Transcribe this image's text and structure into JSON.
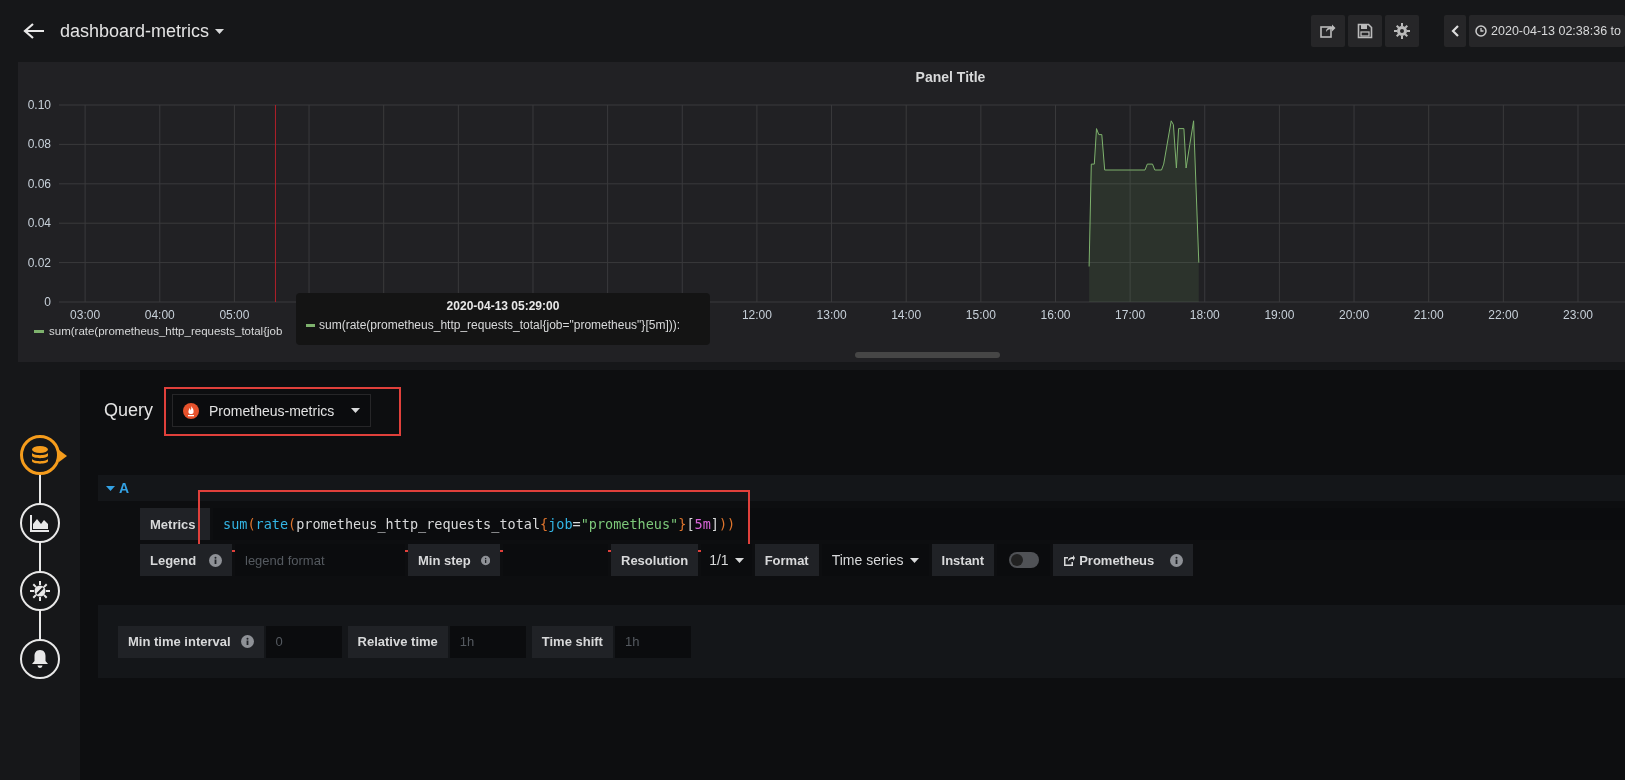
{
  "topbar": {
    "title": "dashboard-metrics",
    "time_range": "2020-04-13 02:38:36 to"
  },
  "panel": {
    "chart_data": {
      "type": "area",
      "title": "Panel Title",
      "x": [
        16.45,
        16.48,
        16.52,
        16.55,
        16.58,
        16.62,
        16.66,
        17.0,
        17.2,
        17.23,
        17.3,
        17.33,
        17.42,
        17.45,
        17.55,
        17.58,
        17.62,
        17.65,
        17.72,
        17.75,
        17.8,
        17.85,
        17.92
      ],
      "series": [
        {
          "name": "sum(rate(prometheus_http_requests_total{job",
          "color": "#7eb26d",
          "values": [
            0.018,
            0.07,
            0.07,
            0.088,
            0.085,
            0.085,
            0.067,
            0.067,
            0.067,
            0.07,
            0.07,
            0.067,
            0.067,
            0.07,
            0.092,
            0.09,
            0.068,
            0.088,
            0.088,
            0.068,
            0.08,
            0.092,
            0.02
          ]
        }
      ],
      "xlim": [
        2.65,
        23.63
      ],
      "ylim": [
        0,
        0.1
      ],
      "xticks": [
        {
          "value": 3,
          "label": "03:00"
        },
        {
          "value": 4,
          "label": "04:00"
        },
        {
          "value": 5,
          "label": "05:00"
        },
        {
          "value": 12,
          "label": "12:00"
        },
        {
          "value": 13,
          "label": "13:00"
        },
        {
          "value": 14,
          "label": "14:00"
        },
        {
          "value": 15,
          "label": "15:00"
        },
        {
          "value": 16,
          "label": "16:00"
        },
        {
          "value": 17,
          "label": "17:00"
        },
        {
          "value": 18,
          "label": "18:00"
        },
        {
          "value": 19,
          "label": "19:00"
        },
        {
          "value": 20,
          "label": "20:00"
        },
        {
          "value": 21,
          "label": "21:00"
        },
        {
          "value": 22,
          "label": "22:00"
        },
        {
          "value": 23,
          "label": "23:00"
        }
      ],
      "yticks": [
        {
          "value": 0,
          "label": "0"
        },
        {
          "value": 0.02,
          "label": "0.02"
        },
        {
          "value": 0.04,
          "label": "0.04"
        },
        {
          "value": 0.06,
          "label": "0.06"
        },
        {
          "value": 0.08,
          "label": "0.08"
        },
        {
          "value": 0.1,
          "label": "0.10"
        }
      ],
      "grid": true,
      "ref_lines": [
        {
          "axis": "x",
          "value": 5.55,
          "color": "#b0202a"
        }
      ]
    },
    "tooltip": {
      "time": "2020-04-13 05:29:00",
      "series": "sum(rate(prometheus_http_requests_total{job=\"prometheus\"}[5m])):"
    }
  },
  "editor": {
    "rail": [
      {
        "kind": "queries",
        "selected": true
      },
      {
        "kind": "visualization",
        "selected": false
      },
      {
        "kind": "general",
        "selected": false
      },
      {
        "kind": "alert",
        "selected": false
      }
    ],
    "query_label": "Query",
    "datasource": {
      "name": "Prometheus-metrics",
      "highlighted": true
    },
    "query": {
      "ref": "A",
      "expanded": true,
      "metrics_label": "Metrics",
      "highlighted": true,
      "expression": [
        {
          "text": "sum",
          "kind": "function"
        },
        {
          "text": "(",
          "kind": "paren"
        },
        {
          "text": "rate",
          "kind": "function"
        },
        {
          "text": "(",
          "kind": "paren"
        },
        {
          "text": "prometheus_http_requests_total",
          "kind": "metric"
        },
        {
          "text": "{",
          "kind": "paren"
        },
        {
          "text": "job",
          "kind": "label"
        },
        {
          "text": "=",
          "kind": "operator"
        },
        {
          "text": "\"prometheus\"",
          "kind": "string"
        },
        {
          "text": "}",
          "kind": "paren"
        },
        {
          "text": "[",
          "kind": "bracket"
        },
        {
          "text": "5m",
          "kind": "duration"
        },
        {
          "text": "]",
          "kind": "bracket"
        },
        {
          "text": "))",
          "kind": "paren"
        }
      ],
      "legend_label": "Legend",
      "legend_placeholder": "legend format",
      "min_step_label": "Min step",
      "resolution_label": "Resolution",
      "resolution": "1/1",
      "format_label": "Format",
      "format": "Time series",
      "instant_label": "Instant",
      "instant": false,
      "link": "Prometheus"
    },
    "options": [
      {
        "label": "Min time interval",
        "info": true,
        "placeholder": "0"
      },
      {
        "label": "Relative time",
        "placeholder": "1h"
      },
      {
        "label": "Time shift",
        "placeholder": "1h"
      }
    ]
  }
}
